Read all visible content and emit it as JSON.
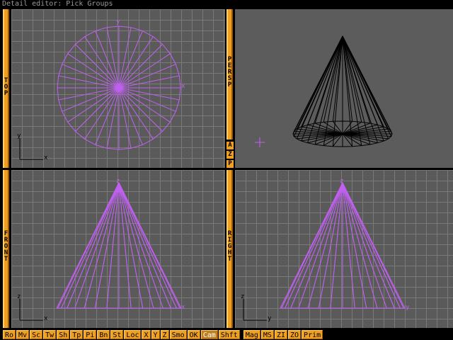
{
  "window": {
    "title": "Detail editor: Pick Groups"
  },
  "viewports": {
    "top": {
      "label": "TOP",
      "axis_h": "x",
      "axis_v": "y"
    },
    "persp": {
      "label": "PERSP",
      "azp": [
        "A",
        "Z",
        "P"
      ]
    },
    "front": {
      "label": "FRONT",
      "axis_h": "x",
      "axis_v": "z"
    },
    "right": {
      "label": "RIGHT",
      "axis_h": "y",
      "axis_v": "z"
    }
  },
  "markers": {
    "top_x": "x",
    "top_y": "y",
    "front_z": "z",
    "front_x": "x",
    "right_z": "z",
    "right_y": "y"
  },
  "colors": {
    "wire_selected": "#c060f0",
    "wire_plain": "#000000",
    "panel_tab": "#f0a020",
    "grid_bg": "#5a5a5a"
  },
  "toolbar": {
    "buttons": [
      "Ro",
      "Mv",
      "Sc",
      "Tw",
      "Sh",
      "Tp",
      "Pi",
      "Bn",
      "St",
      "Loc",
      "X",
      "Y",
      "Z",
      "Smo",
      "OK",
      "Cam",
      "Shft",
      "Mag",
      "MS",
      "ZI",
      "ZO",
      "Prim"
    ],
    "active": "Cam"
  }
}
